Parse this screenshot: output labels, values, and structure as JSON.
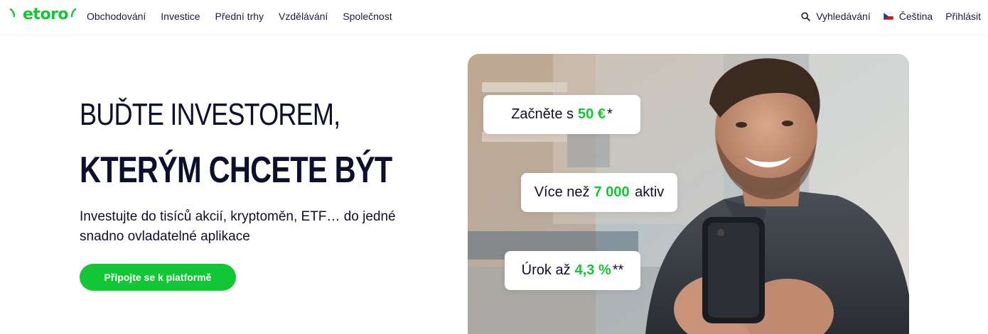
{
  "header": {
    "logo_text": "etoro",
    "nav": [
      "Obchodování",
      "Investice",
      "Přední trhy",
      "Vzdělávání",
      "Společnost"
    ],
    "search_label": "Vyhledávání",
    "language_label": "Čeština",
    "login_label": "Přihlásit"
  },
  "hero": {
    "headline_line1": "BUĎTE INVESTOREM,",
    "headline_line2": "KTERÝM CHCETE BÝT",
    "subtitle": "Investujte do tisíců akcií, kryptoměn, ETF… do jedné snadno ovladatelné aplikace",
    "cta_label": "Připojte se k platformě"
  },
  "cards": {
    "card1": {
      "prefix": "Začněte s",
      "highlight": "50 €",
      "suffix": "*"
    },
    "card2": {
      "prefix": "Více než",
      "highlight": "7 000",
      "suffix": " aktiv"
    },
    "card3": {
      "prefix": "Úrok až",
      "highlight": "4,3 %",
      "suffix": "**"
    }
  },
  "colors": {
    "brand_green": "#13c636",
    "text_dark": "#0e0f2b"
  },
  "icons": [
    "search-icon",
    "czech-flag-icon",
    "etoro-logo"
  ]
}
